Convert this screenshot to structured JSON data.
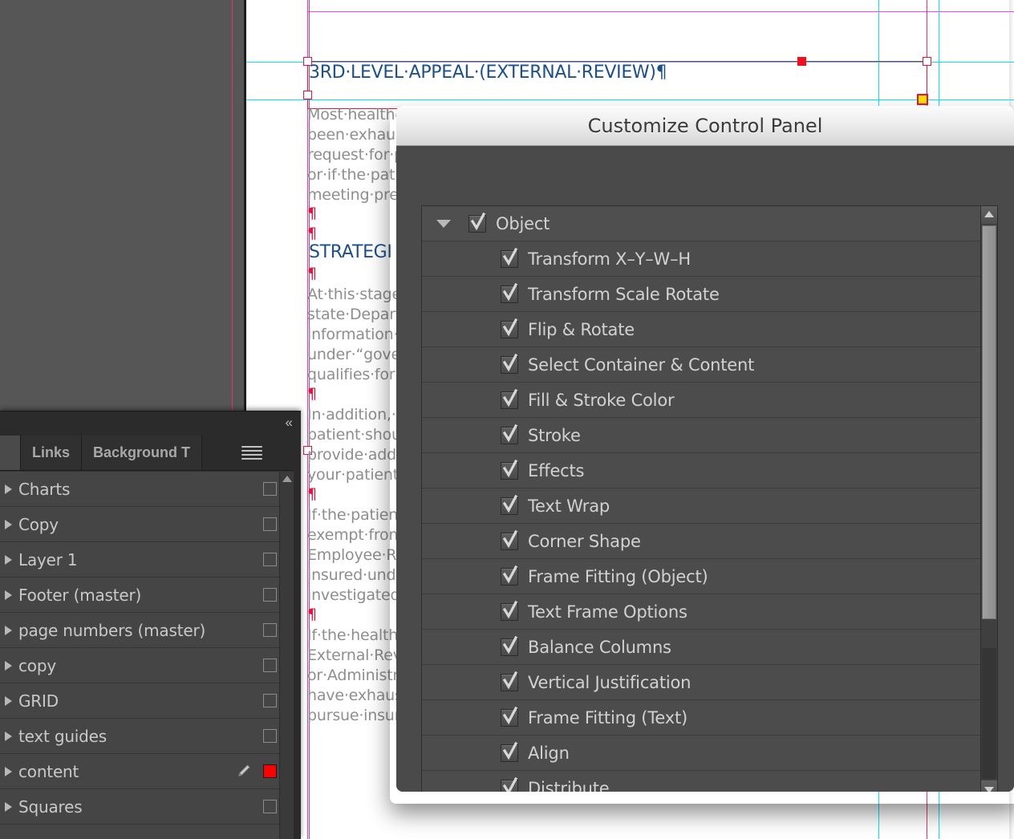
{
  "app": {
    "canvas_background": "#565656",
    "page_background": "#ffffff",
    "guide_cyan": "#00e5ff",
    "guide_magenta": "#ff3fff",
    "margin_red": "#e8306a",
    "selection_red": "#e8133c",
    "handle_yellow": "#ffe000"
  },
  "document": {
    "heading_main": "3RD·LEVEL·APPEAL·(EXTERNAL·REVIEW)¶",
    "heading_main_color": "#1c4f8c",
    "paragraph_1": [
      "Most·healthc",
      "been·exhaus",
      "request·for·p",
      "or·if·the·pati",
      "meeting·pre"
    ],
    "heading_secondary": "STRATEGI",
    "paragraph_2": [
      "At·this·stage",
      "state·Depart",
      "information·",
      "under·“gove",
      "qualifies·for·"
    ],
    "paragraph_3": [
      "In·addition,·i",
      "patient·shou",
      "provide·addi",
      "your·patient"
    ],
    "paragraph_4": [
      "If·the·patient",
      "exempt·from",
      "Employee·Re",
      "insured·unde",
      "investigated"
    ],
    "paragraph_5": [
      "If·the·healthc",
      "External·Rev",
      "or·Administr",
      "have·exhaus",
      "pursue·insur"
    ]
  },
  "layers_panel": {
    "collapse_icon": "«",
    "menu_icon": "hamburger-icon",
    "tabs": [
      {
        "label": "",
        "active": true,
        "clipped": true
      },
      {
        "label": "Links",
        "active": false,
        "clipped": false
      },
      {
        "label": "Background T",
        "active": false,
        "clipped": false
      }
    ],
    "layers": [
      {
        "name": "Charts",
        "swatch": "none",
        "pen": false
      },
      {
        "name": "Copy",
        "swatch": "none",
        "pen": false
      },
      {
        "name": "Layer 1",
        "swatch": "none",
        "pen": false
      },
      {
        "name": "Footer (master)",
        "swatch": "none",
        "pen": false
      },
      {
        "name": "page numbers (master)",
        "swatch": "none",
        "pen": false
      },
      {
        "name": "copy",
        "swatch": "none",
        "pen": false
      },
      {
        "name": "GRID",
        "swatch": "none",
        "pen": false
      },
      {
        "name": "text guides",
        "swatch": "none",
        "pen": false
      },
      {
        "name": "content",
        "swatch": "#ff0000",
        "pen": true
      },
      {
        "name": "Squares",
        "swatch": "none",
        "pen": false
      }
    ]
  },
  "dialog": {
    "title": "Customize Control Panel",
    "title_bar_color": "#ededed",
    "body_color": "#4a4a4a",
    "options": [
      {
        "label": "Object",
        "checked": true,
        "level": 0,
        "group": true
      },
      {
        "label": "Transform X–Y–W–H",
        "checked": true,
        "level": 1,
        "group": false
      },
      {
        "label": "Transform Scale Rotate",
        "checked": true,
        "level": 1,
        "group": false
      },
      {
        "label": "Flip & Rotate",
        "checked": true,
        "level": 1,
        "group": false
      },
      {
        "label": "Select Container & Content",
        "checked": true,
        "level": 1,
        "group": false
      },
      {
        "label": "Fill & Stroke Color",
        "checked": true,
        "level": 1,
        "group": false
      },
      {
        "label": "Stroke",
        "checked": true,
        "level": 1,
        "group": false
      },
      {
        "label": "Effects",
        "checked": true,
        "level": 1,
        "group": false
      },
      {
        "label": "Text Wrap",
        "checked": true,
        "level": 1,
        "group": false
      },
      {
        "label": "Corner Shape",
        "checked": true,
        "level": 1,
        "group": false
      },
      {
        "label": "Frame Fitting (Object)",
        "checked": true,
        "level": 1,
        "group": false
      },
      {
        "label": "Text Frame Options",
        "checked": true,
        "level": 1,
        "group": false
      },
      {
        "label": "Balance Columns",
        "checked": true,
        "level": 1,
        "group": false
      },
      {
        "label": "Vertical Justification",
        "checked": true,
        "level": 1,
        "group": false
      },
      {
        "label": "Frame Fitting (Text)",
        "checked": true,
        "level": 1,
        "group": false
      },
      {
        "label": "Align",
        "checked": true,
        "level": 1,
        "group": false
      },
      {
        "label": "Distribute",
        "checked": true,
        "level": 1,
        "group": false
      }
    ],
    "scrollbar": {
      "thumb_fraction": 0.71,
      "up_arrow": "scroll-up-arrow",
      "down_arrow": "scroll-down-arrow"
    }
  }
}
